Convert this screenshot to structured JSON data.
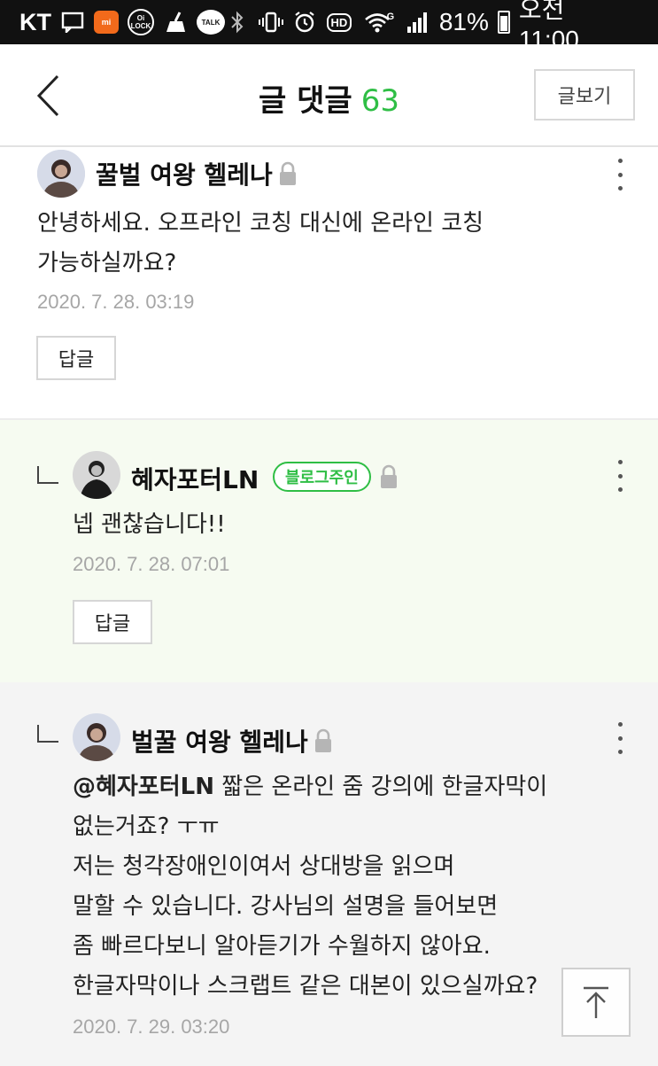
{
  "status_bar": {
    "carrier": "KT",
    "mi_label": "mi",
    "lock_label": "Oi LOCK",
    "talk_label": "TALK",
    "hd_label": "HD",
    "network": "G",
    "battery": "81%",
    "time": "오전 11:00"
  },
  "header": {
    "title": "글 댓글",
    "count": "63",
    "view_post_label": "글보기"
  },
  "comments": [
    {
      "author": "꿀벌 여왕 헬레나",
      "text": "안녕하세요. 오프라인 코칭 대신에 온라인 코칭\n가능하실까요?",
      "date": "2020. 7. 28. 03:19",
      "reply_label": "답글"
    },
    {
      "author": "혜자포터LN",
      "badge": "블로그주인",
      "text": "넵 괜찮습니다!!",
      "date": "2020. 7. 28. 07:01",
      "reply_label": "답글"
    },
    {
      "author": "벌꿀 여왕 헬레나",
      "mention": "@혜자포터LN",
      "text": " 짧은 온라인 줌 강의에 한글자막이\n없는거죠? ㅜㅠ\n저는 청각장애인이여서 상대방을 읽으며\n말할 수 있습니다. 강사님의 설명을 들어보면\n좀 빠르다보니 알아듣기가 수월하지 않아요.\n한글자막이나 스크랩트 같은 대본이 있으실까요?",
      "date": "2020. 7. 29. 03:20"
    }
  ],
  "colors": {
    "accent": "#2fbe45",
    "owner_bg": "#f6fbf1",
    "date_text": "#a6a6a6"
  }
}
